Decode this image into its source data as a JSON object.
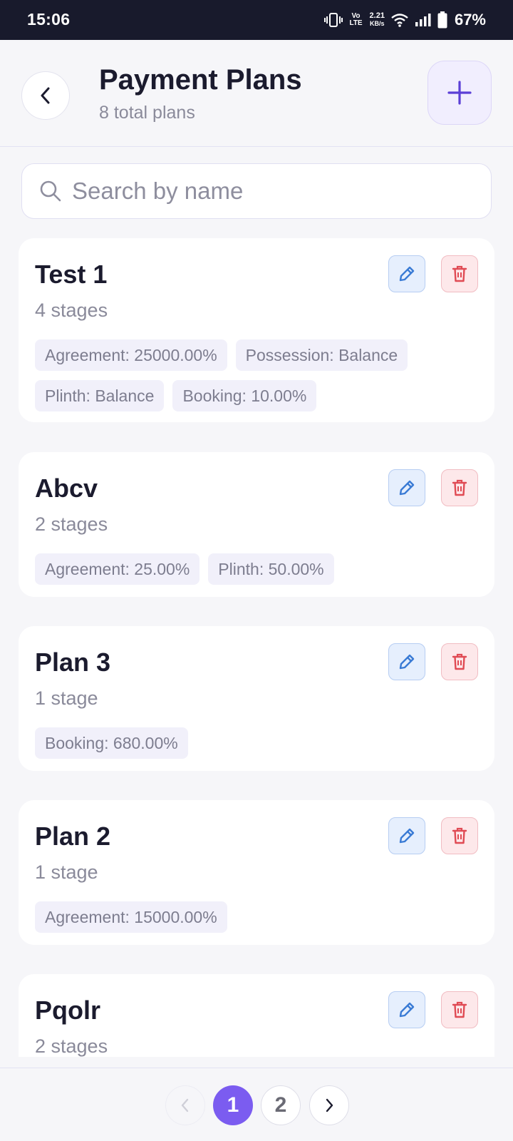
{
  "status_bar": {
    "time": "15:06",
    "network_small": "Vo LTE",
    "speed_value": "2.21",
    "speed_unit": "KB/s",
    "battery": "67%"
  },
  "header": {
    "title": "Payment Plans",
    "subtitle": "8 total plans"
  },
  "search": {
    "placeholder": "Search by name",
    "value": ""
  },
  "plans": [
    {
      "name": "Test 1",
      "stages": "4 stages",
      "chips": [
        "Agreement: 25000.00%",
        "Possession: Balance",
        "Plinth: Balance",
        "Booking: 10.00%"
      ]
    },
    {
      "name": "Abcv",
      "stages": "2 stages",
      "chips": [
        "Agreement: 25.00%",
        "Plinth: 50.00%"
      ]
    },
    {
      "name": "Plan 3",
      "stages": "1 stage",
      "chips": [
        "Booking: 680.00%"
      ]
    },
    {
      "name": "Plan 2",
      "stages": "1 stage",
      "chips": [
        "Agreement: 15000.00%"
      ]
    },
    {
      "name": "Pqolr",
      "stages": "2 stages",
      "chips": []
    }
  ],
  "pagination": {
    "pages": [
      "1",
      "2"
    ],
    "current": "1"
  },
  "colors": {
    "accent": "#7b5cf0",
    "edit": "#3a7bd5",
    "delete": "#e04b54"
  }
}
